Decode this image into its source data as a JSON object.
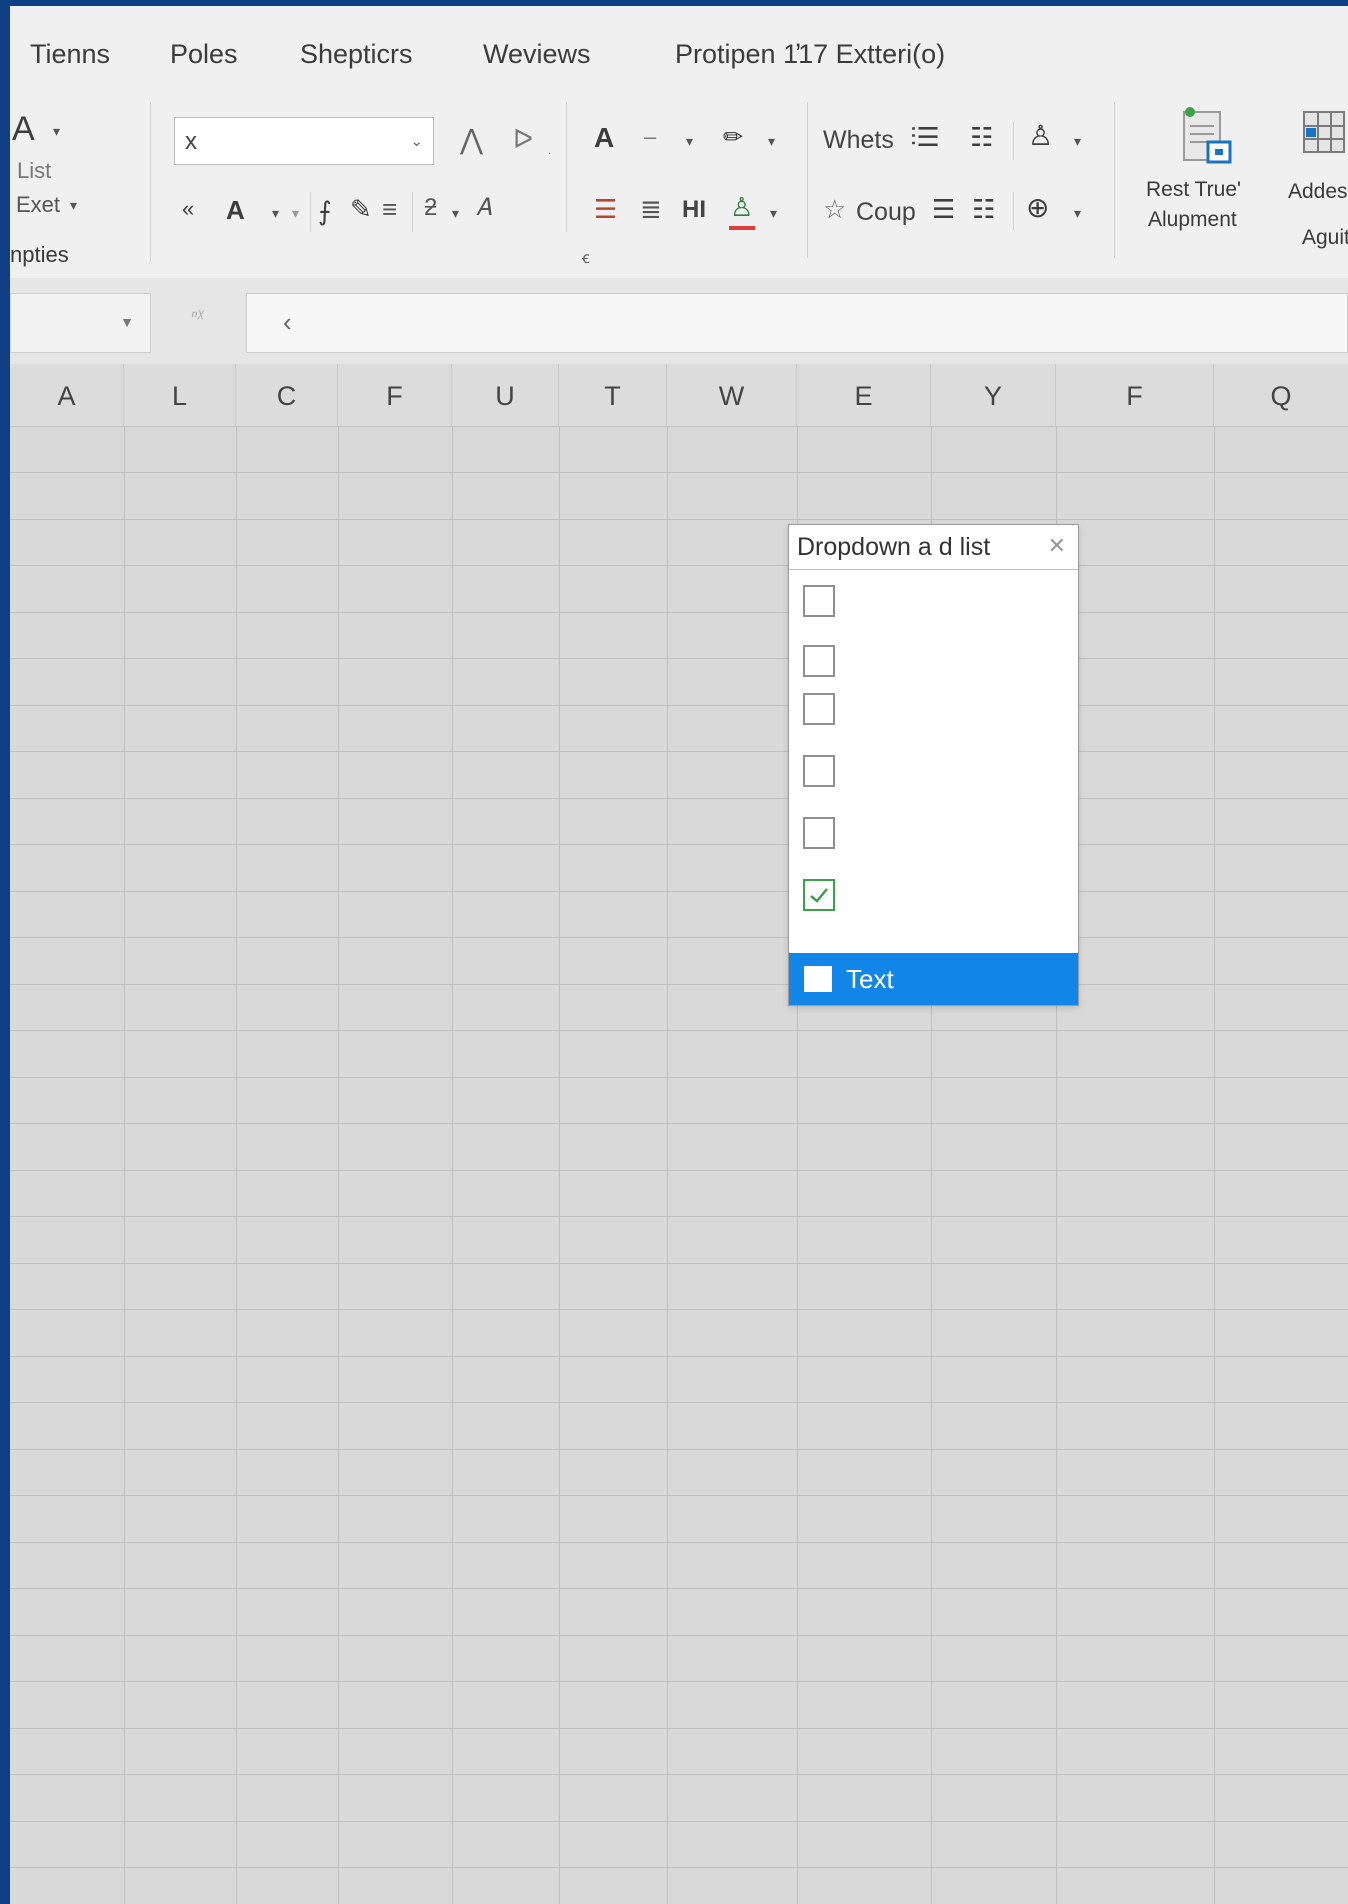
{
  "menu": {
    "tabs": [
      "Tienns",
      "Poles",
      "Shepticrs",
      "Weviews",
      "Protipen 1̓17 Extteri(o)"
    ]
  },
  "ribbon": {
    "left_group": {
      "icon_letter": "A",
      "list_label": "List",
      "exet_label": "Exet",
      "group_label": "npties"
    },
    "font_box_value": "x",
    "font_group_label": "ꞓ",
    "font_icons": {
      "row1_bold_a": "A",
      "row2_bold_a": "A",
      "hi_label": "HI"
    },
    "align_group": {
      "whets_label": "Whets",
      "coup_label": "Coup"
    },
    "big_buttons": [
      {
        "label_line1": "Rest True'",
        "label_line2": "Alupment"
      },
      {
        "label_line1": "Addes",
        "label_line2": "Aguit"
      }
    ]
  },
  "dropdown": {
    "title": "Dropdown a d list",
    "checkboxes": [
      {
        "checked": false
      },
      {
        "checked": false
      },
      {
        "checked": false
      },
      {
        "checked": false
      },
      {
        "checked": false
      },
      {
        "checked": true
      }
    ],
    "selected_item_label": "Text"
  },
  "grid": {
    "columns": [
      "A",
      "L",
      "C",
      "F",
      "U",
      "T",
      "W",
      "E",
      "Y",
      "F",
      "Q"
    ]
  },
  "colors": {
    "window_frame": "#0e3f86",
    "ribbon_bg": "#f0f0f0",
    "grid_bg": "#d9d9d9",
    "selected_item": "#1186e8",
    "check_green": "#3ba24a"
  }
}
